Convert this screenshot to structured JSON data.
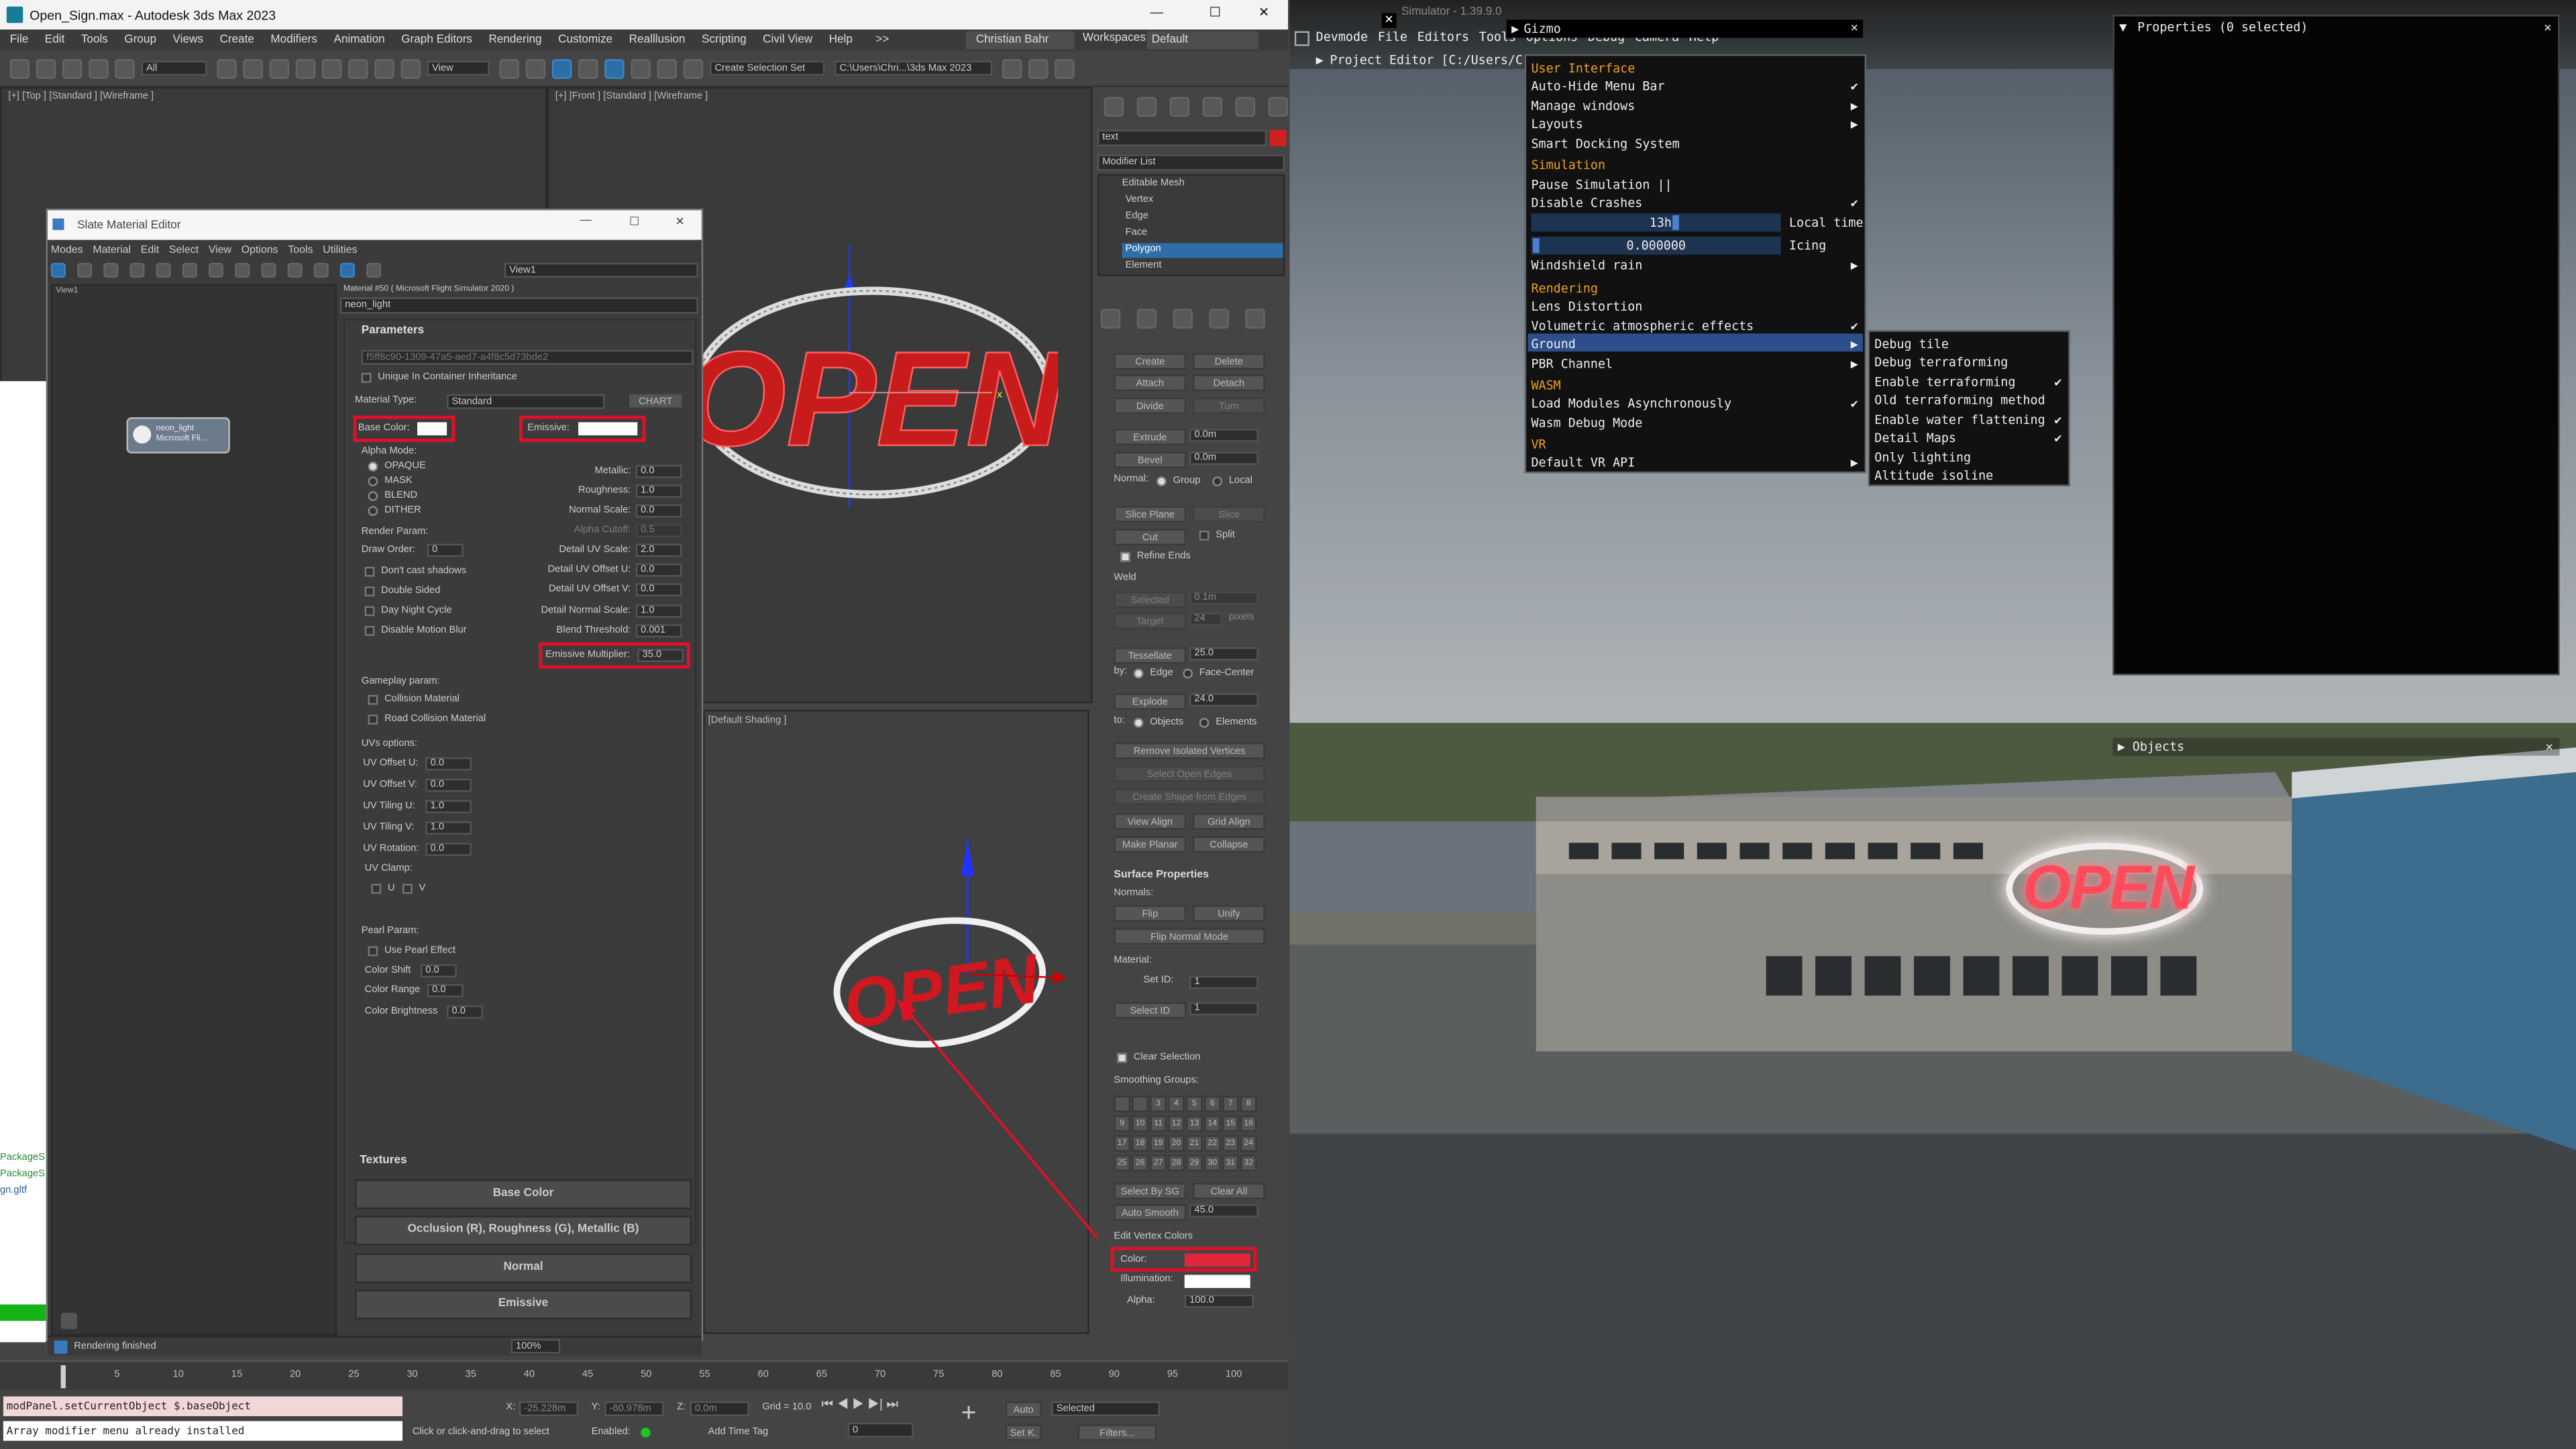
{
  "max": {
    "window_title": "Open_Sign.max - Autodesk 3ds Max 2023",
    "win_controls": [
      "—",
      "☐",
      "✕"
    ],
    "menu": [
      "File",
      "Edit",
      "Tools",
      "Group",
      "Views",
      "Create",
      "Modifiers",
      "Animation",
      "Graph Editors",
      "Rendering",
      "Customize",
      "Realllusion",
      "Scripting",
      "Civil View",
      "Help"
    ],
    "menu_overflow": ">>",
    "user": "Christian Bahr",
    "workspaces_label": "Workspaces:",
    "workspace": "Default",
    "toolbar": {
      "filter": "All",
      "view": "View",
      "selection_set": "Create Selection Set",
      "project_path": "C:\\Users\\Chri...\\3ds Max 2023"
    },
    "viewports": {
      "top": "[+] [Top ] [Standard ] [Wireframe ]",
      "front": "[+] [Front ] [Standard ] [Wireframe ]",
      "shading": "[Default Shading ]"
    },
    "slate": {
      "title": "Slate Material Editor",
      "menu": [
        "Modes",
        "Material",
        "Edit",
        "Select",
        "View",
        "Options",
        "Tools",
        "Utilities"
      ],
      "view_dropdown": "View1",
      "view_tab": "View1",
      "node": {
        "name": "neon_light",
        "sub": "Microsoft Fli..."
      },
      "material_header": "Material #50 ( Microsoft Flight Simulator 2020 )",
      "material_name": "neon_light",
      "parameters_title": "Parameters",
      "guid": "f5ff8c90-1309-47a5-aed7-a4f8c5d73bde2",
      "unique_label": "Unique In Container Inheritance",
      "material_type_label": "Material Type:",
      "material_type": "Standard",
      "chart_btn": "CHART",
      "base_color_label": "Base Color:",
      "emissive_label": "Emissive:",
      "alpha_mode_label": "Alpha Mode:",
      "alpha_modes": [
        "OPAQUE",
        "MASK",
        "BLEND",
        "DITHER"
      ],
      "right_params": [
        {
          "label": "Metallic:",
          "value": "0.0"
        },
        {
          "label": "Roughness:",
          "value": "1.0"
        },
        {
          "label": "Normal Scale:",
          "value": "0.0"
        },
        {
          "label": "Alpha Cutoff:",
          "value": "0.5"
        },
        {
          "label": "Detail UV Scale:",
          "value": "2.0"
        },
        {
          "label": "Detail UV Offset U:",
          "value": "0.0"
        },
        {
          "label": "Detail UV Offset V:",
          "value": "0.0"
        },
        {
          "label": "Detail Normal Scale:",
          "value": "1.0"
        },
        {
          "label": "Blend Threshold:",
          "value": "0.001"
        }
      ],
      "emissive_mult_label": "Emissive Multiplier:",
      "emissive_mult_value": "35.0",
      "render_param_label": "Render Param:",
      "draw_order_label": "Draw Order:",
      "draw_order_value": "0",
      "render_checks": [
        "Don't cast shadows",
        "Double Sided",
        "Day Night Cycle",
        "Disable Motion Blur"
      ],
      "gameplay_label": "Gameplay param:",
      "gameplay_checks": [
        "Collision Material",
        "Road Collision Material"
      ],
      "uv_label": "UVs options:",
      "uv_params": [
        {
          "label": "UV Offset U:",
          "value": "0.0"
        },
        {
          "label": "UV Offset V:",
          "value": "0.0"
        },
        {
          "label": "UV Tiling U:",
          "value": "1.0"
        },
        {
          "label": "UV Tiling V:",
          "value": "1.0"
        },
        {
          "label": "UV Rotation:",
          "value": "0.0"
        }
      ],
      "uv_clamp_label": "UV Clamp:",
      "uv_clamp": [
        "U",
        "V"
      ],
      "pearl_label": "Pearl Param:",
      "pearl_check": "Use Pearl Effect",
      "pearl_params": [
        {
          "label": "Color Shift",
          "value": "0.0"
        },
        {
          "label": "Color Range",
          "value": "0.0"
        },
        {
          "label": "Color Brightness",
          "value": "0.0"
        }
      ],
      "textures_title": "Textures",
      "texture_buttons": [
        "Base Color",
        "Occlusion (R), Roughness (G), Metallic (B)",
        "Normal",
        "Emissive"
      ],
      "status": "Rendering finished",
      "zoom": "100%"
    },
    "command_panel": {
      "object_name": "text",
      "modifier_list": "Modifier List",
      "stack": [
        "Editable Mesh",
        "Vertex",
        "Edge",
        "Face",
        "Polygon",
        "Element"
      ],
      "create": "Create",
      "delete": "Delete",
      "attach": "Attach",
      "detach": "Detach",
      "divide": "Divide",
      "turn": "Turn",
      "extrude_label": "Extrude",
      "extrude_value": "0.0m",
      "bevel_label": "Bevel",
      "bevel_value": "0.0m",
      "normal_label": "Normal:",
      "normal_group": "Group",
      "normal_local": "Local",
      "slice_plane": "Slice Plane",
      "slice": "Slice",
      "cut": "Cut",
      "split": "Split",
      "refine_ends": "Refine Ends",
      "weld_label": "Weld",
      "weld_selected": "Selected",
      "weld_selected_value": "0.1m",
      "weld_target": "Target",
      "weld_target_value": "24",
      "weld_pixels": "pixels",
      "tessellate": "Tessellate",
      "tessellate_value": "25.0",
      "by_label": "by:",
      "by_edge": "Edge",
      "by_face_center": "Face-Center",
      "explode": "Explode",
      "explode_value": "24.0",
      "to_label": "to:",
      "to_objects": "Objects",
      "to_elements": "Elements",
      "remove_isolated": "Remove Isolated Vertices",
      "select_open": "Select Open Edges",
      "create_shape": "Create Shape from Edges",
      "view_align": "View Align",
      "grid_align": "Grid Align",
      "make_planar": "Make Planar",
      "collapse": "Collapse",
      "surface_props": "Surface Properties",
      "normals_label": "Normals:",
      "flip": "Flip",
      "unify": "Unify",
      "flip_normal_mode": "Flip Normal Mode",
      "material_label": "Material:",
      "set_id_label": "Set ID:",
      "set_id_value": "1",
      "select_id_label": "Select ID",
      "select_id_value": "1",
      "clear_selection": "Clear Selection",
      "smoothing_label": "Smoothing Groups:",
      "smoothing": [
        "3",
        "4",
        "5",
        "6",
        "7",
        "8",
        "9",
        "10",
        "11",
        "12",
        "13",
        "14",
        "15",
        "16",
        "17",
        "18",
        "19",
        "20",
        "21",
        "22",
        "23",
        "24",
        "25",
        "26",
        "27",
        "28",
        "29",
        "30",
        "31",
        "32"
      ],
      "select_by_sg": "Select By SG",
      "clear_all": "Clear All",
      "auto_smooth": "Auto Smooth",
      "auto_smooth_value": "45.0",
      "edit_vertex_colors": "Edit Vertex Colors",
      "color_label": "Color:",
      "illumination_label": "Illumination:",
      "alpha_label": "Alpha:",
      "alpha_value": "100.0"
    },
    "timeline": [
      "5",
      "10",
      "15",
      "20",
      "25",
      "30",
      "35",
      "40",
      "45",
      "50",
      "55",
      "60",
      "65",
      "70",
      "75",
      "80",
      "85",
      "90",
      "95",
      "100"
    ],
    "maxscript_line1": "modPanel.setCurrentObject $.baseObject",
    "maxscript_line2": "Array modifier menu already installed",
    "status_bar": {
      "x_label": "X:",
      "x_value": "-25.228m",
      "y_label": "Y:",
      "y_value": "-60.978m",
      "z_label": "Z:",
      "z_value": "0.0m",
      "grid": "Grid = 10.0",
      "hint": "Click or click-and-drag to select",
      "enabled": "Enabled:",
      "add_time_tag": "Add Time Tag",
      "auto": "Auto",
      "set_key": "Set K.",
      "selected": "Selected",
      "filters": "Filters...",
      "frame": "0"
    },
    "left_strip": [
      "PackageS",
      "PackageS",
      "gn.gltf"
    ],
    "colors": {
      "accent_red": "#e0102a",
      "emissive_swatch": "#ffffff",
      "vertex_color": "#e0263a",
      "selection_blue": "#2d6ea8"
    }
  },
  "msfs": {
    "window_title": "Simulator - 1.39.9.0",
    "dev_menu": [
      "Devmode",
      "File",
      "Editors",
      "Tools",
      "Options",
      "Debug",
      "Camera",
      "Help"
    ],
    "project_editor": "Project Editor [C:/Users/C",
    "gizmo_title": "Gizmo",
    "properties_title": "Properties (0 selected)",
    "objects_title": "Objects",
    "options_menu": {
      "sections": [
        {
          "header": "User Interface",
          "items": [
            {
              "label": "Auto-Hide Menu Bar",
              "check": true
            },
            {
              "label": "Manage windows",
              "arrow": true
            },
            {
              "label": "Layouts",
              "arrow": true
            },
            {
              "label": "Smart Docking System"
            }
          ]
        },
        {
          "header": "Simulation",
          "items": [
            {
              "label": "Pause Simulation ||"
            },
            {
              "label": "Disable Crashes",
              "check": true
            }
          ]
        }
      ],
      "time_value": "13h",
      "time_label": "Local time",
      "icing_value": "0.000000",
      "icing_label": "Icing",
      "windshield": "Windshield rain",
      "rendering_header": "Rendering",
      "rendering_items": [
        "Lens Distortion",
        "Volumetric atmospheric effects",
        "Ground",
        "PBR Channel"
      ],
      "wasm_header": "WASM",
      "wasm_items": [
        "Load Modules Asynchronously",
        "Wasm Debug Mode"
      ],
      "vr_header": "VR",
      "vr_items": [
        "Default VR API"
      ]
    },
    "ground_submenu": [
      {
        "label": "Debug tile",
        "check": false
      },
      {
        "label": "Debug terraforming",
        "check": false
      },
      {
        "label": "Enable terraforming",
        "check": true
      },
      {
        "label": "Old terraforming method",
        "check": false
      },
      {
        "label": "Enable water flattening",
        "check": true
      },
      {
        "label": "Detail Maps",
        "check": true
      },
      {
        "label": "Only lighting",
        "check": false
      },
      {
        "label": "Altitude isoline",
        "check": false
      }
    ],
    "sign_text": "OPEN",
    "colors": {
      "menu_header": "#f0a020",
      "menu_bg": "#111111",
      "highlight": "#2d4e8a"
    }
  }
}
